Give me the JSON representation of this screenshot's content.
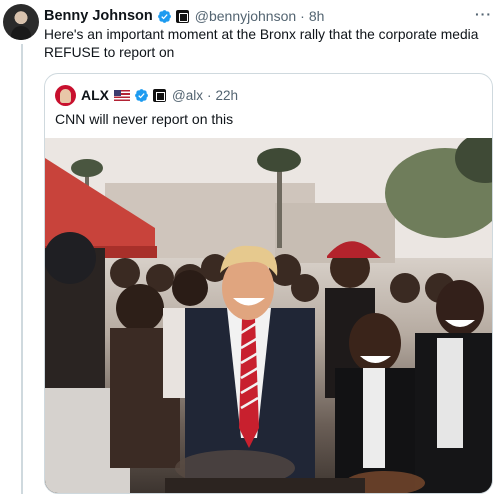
{
  "tweet": {
    "author_name": "Benny Johnson",
    "author_handle": "@bennyjohnson",
    "separator": "·",
    "time": "8h",
    "more_label": "···",
    "text": "Here's an important moment at the Bronx rally that the corporate media REFUSE to report on"
  },
  "quote": {
    "author_name": "ALX",
    "author_handle": "@alx",
    "separator": "·",
    "time": "22h",
    "text": "CNN will never report on this"
  },
  "icons": {
    "verified": "verified-badge-icon",
    "affiliate": "affiliate-badge-icon",
    "flag": "us-flag-icon",
    "more": "more-options-icon"
  },
  "colors": {
    "verified_blue": "#1d9bf0",
    "text_primary": "#0f1419",
    "text_secondary": "#536471",
    "border": "#cfd9de"
  }
}
